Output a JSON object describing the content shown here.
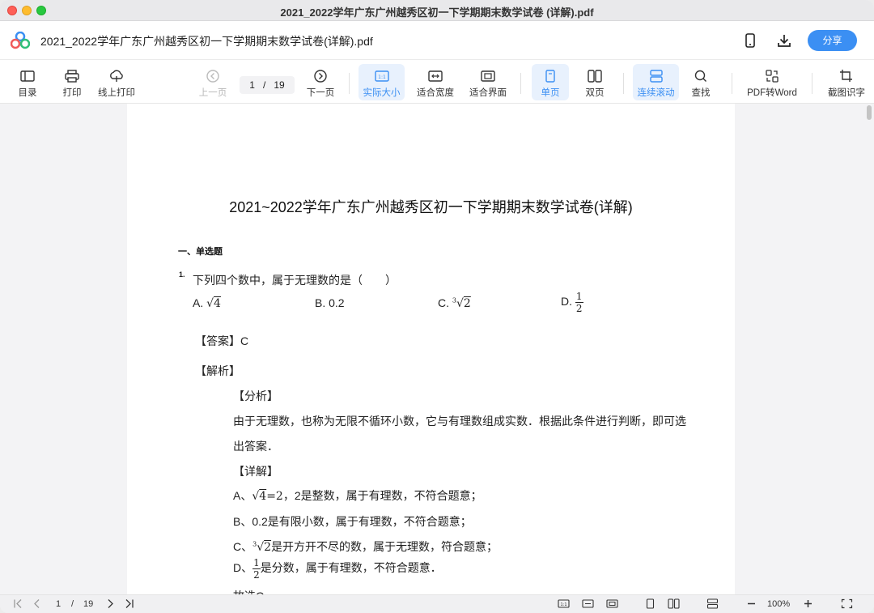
{
  "window": {
    "title": "2021_2022学年广东广州越秀区初一下学期期末数学试卷 (详解).pdf"
  },
  "header": {
    "doc_name": "2021_2022学年广东广州越秀区初一下学期期末数学试卷(详解).pdf",
    "share_label": "分享"
  },
  "toolbar": {
    "toc": "目录",
    "print": "打印",
    "online_print": "线上打印",
    "prev": "上一页",
    "page_current": "1",
    "page_sep": "/",
    "page_total": "19",
    "next": "下一页",
    "actual_size": "实际大小",
    "fit_width": "适合宽度",
    "fit_page": "适合界面",
    "single_page": "单页",
    "double_page": "双页",
    "continuous": "连续滚动",
    "find": "查找",
    "pdf_to_word": "PDF转Word",
    "ocr": "截图识字"
  },
  "document": {
    "title": "2021~2022学年广东广州越秀区初一下学期期末数学试卷(详解)",
    "section": "一、单选题",
    "q_num": "1.",
    "q_text": "下列四个数中，属于无理数的是（　　）",
    "opt_a_label": "A.",
    "opt_a_math": "4",
    "opt_b": "B. 0.2",
    "opt_c_label": "C.",
    "opt_c_math": "2",
    "opt_d_label": "D.",
    "opt_d_num": "1",
    "opt_d_den": "2",
    "answer": "【答案】C",
    "analysis": "【解析】",
    "fenxi": "【分析】",
    "fenxi_line1": "由于无理数，也称为无限不循环小数，它与有理数组成实数．根据此条件进行判断，即可选",
    "fenxi_line2": "出答案．",
    "xiangjie": "【详解】",
    "line_a_pre": "A、",
    "line_a_math": "4",
    "line_a_eq": "=2",
    "line_a_post": "，2是整数，属于有理数，不符合题意；",
    "line_b": "B、0.2是有限小数，属于有理数，不符合题意；",
    "line_c_pre": "C、",
    "line_c_math": "2",
    "line_c_post": "是开方开不尽的数，属于无理数，符合题意；",
    "line_d_pre": "D、",
    "line_d_num": "1",
    "line_d_den": "2",
    "line_d_post": "是分数，属于有理数，不符合题意．",
    "line_end": "故选C．"
  },
  "bottombar": {
    "page_current": "1",
    "page_sep": "/",
    "page_total": "19",
    "zoom": "100%"
  }
}
